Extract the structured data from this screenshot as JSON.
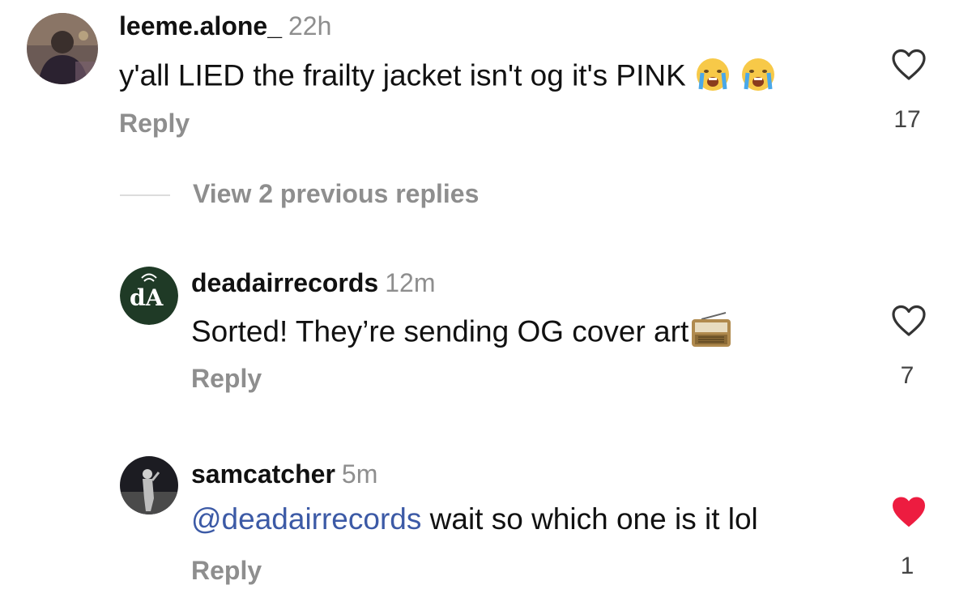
{
  "comments": [
    {
      "username": "leeme.alone_",
      "time": "22h",
      "text": "y'all LIED the frailty jacket isn't og it's PINK",
      "emojis": [
        "crying-face-emoji",
        "crying-face-emoji"
      ],
      "reply_label": "Reply",
      "likes": "17",
      "liked": false
    },
    {
      "username": "deadairrecords",
      "time": "12m",
      "text": "Sorted! They’re sending OG cover art",
      "emojis": [
        "radio-emoji"
      ],
      "avatar_logo_text": "dA",
      "reply_label": "Reply",
      "likes": "7",
      "liked": false
    },
    {
      "username": "samcatcher",
      "time": "5m",
      "mention": "@deadairrecords",
      "text": " wait so which one is it lol",
      "reply_label": "Reply",
      "likes": "1",
      "liked": true
    }
  ],
  "view_previous_replies": "View 2 previous replies",
  "colors": {
    "heart_liked": "#ed1c40",
    "heart_outline": "#333333",
    "mention": "#3c5aa6",
    "secondary_text": "#8e8e8e",
    "avatar_green": "#1f3a26"
  }
}
